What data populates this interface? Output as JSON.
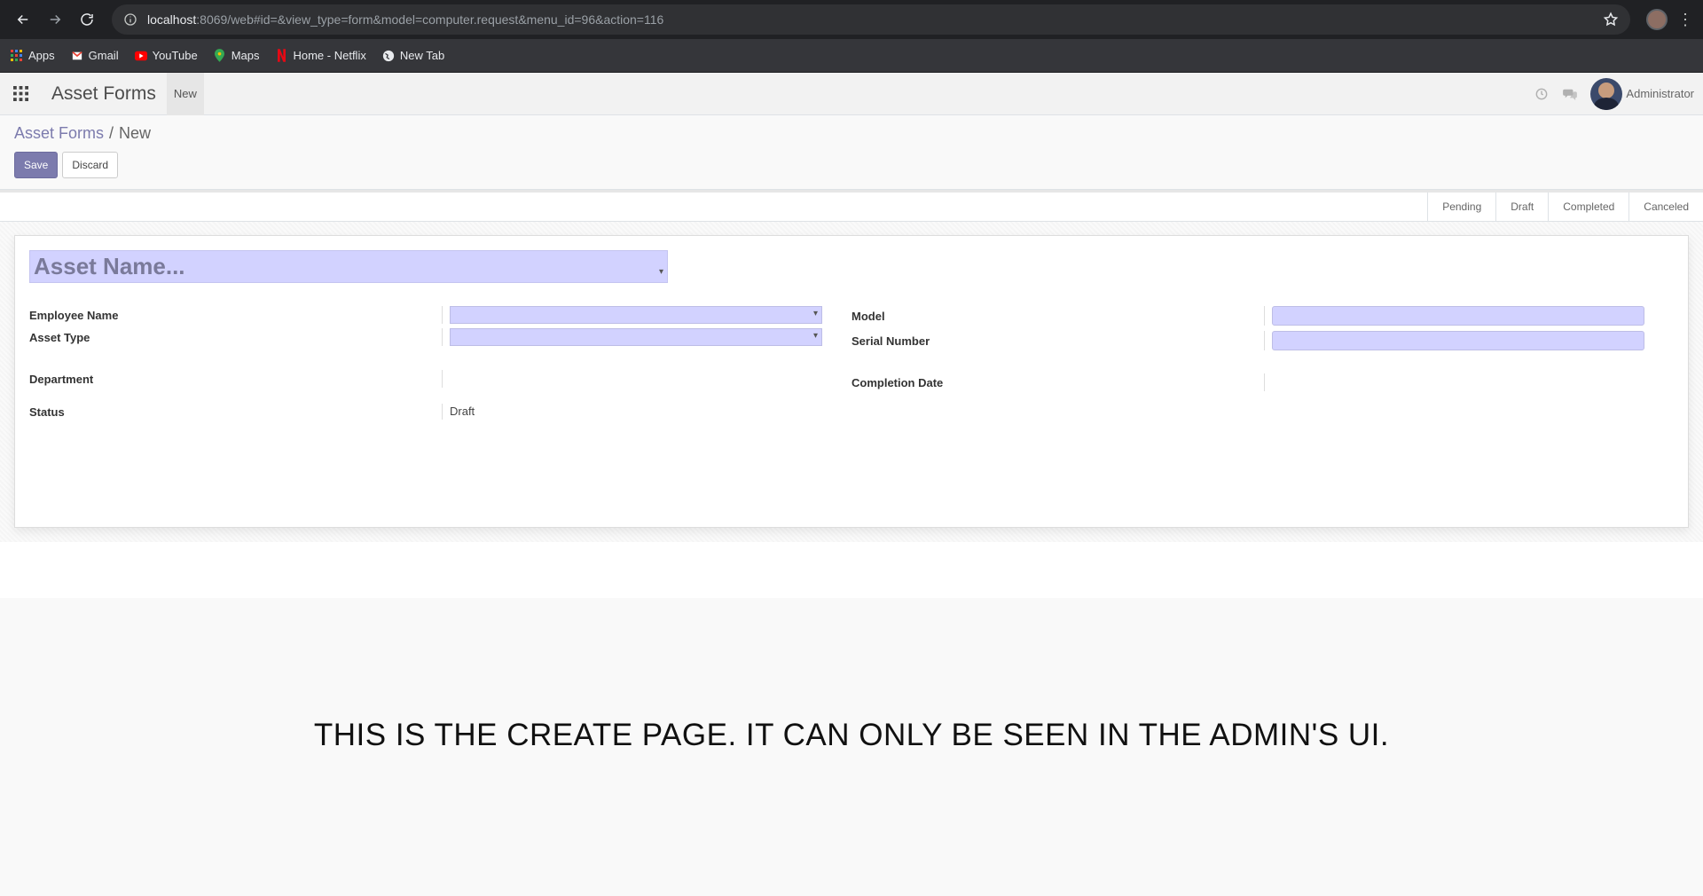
{
  "browser": {
    "url_host": "localhost",
    "url_rest": ":8069/web#id=&view_type=form&model=computer.request&menu_id=96&action=116",
    "bookmarks": [
      {
        "label": "Apps",
        "icon": "apps-grid-icon"
      },
      {
        "label": "Gmail",
        "icon": "gmail-icon"
      },
      {
        "label": "YouTube",
        "icon": "youtube-icon"
      },
      {
        "label": "Maps",
        "icon": "maps-icon"
      },
      {
        "label": "Home - Netflix",
        "icon": "netflix-icon"
      },
      {
        "label": "New Tab",
        "icon": "globe-icon"
      }
    ]
  },
  "navbar": {
    "app_title": "Asset Forms",
    "menu_new": "New",
    "user_name": "Administrator"
  },
  "control_panel": {
    "breadcrumb_parent": "Asset Forms",
    "breadcrumb_sep": "/",
    "breadcrumb_current": "New",
    "save_label": "Save",
    "discard_label": "Discard"
  },
  "statusbar": {
    "stages": [
      "Pending",
      "Draft",
      "Completed",
      "Canceled"
    ]
  },
  "form": {
    "name_placeholder": "Asset Name...",
    "left": {
      "employee_name_label": "Employee Name",
      "asset_type_label": "Asset Type",
      "department_label": "Department",
      "status_label": "Status",
      "status_value": "Draft"
    },
    "right": {
      "model_label": "Model",
      "serial_number_label": "Serial Number",
      "completion_date_label": "Completion Date"
    }
  },
  "footer_message": "THIS IS THE CREATE PAGE. IT CAN ONLY BE SEEN IN THE ADMIN'S UI.",
  "colors": {
    "brand": "#7c7bad",
    "required_field": "#d2d2ff"
  }
}
